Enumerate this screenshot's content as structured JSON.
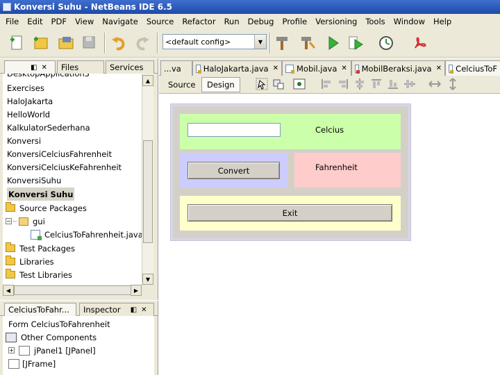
{
  "window": {
    "title": "Konversi Suhu - NetBeans IDE 6.5"
  },
  "menubar": [
    "File",
    "Edit",
    "PDF",
    "View",
    "Navigate",
    "Source",
    "Refactor",
    "Run",
    "Debug",
    "Profile",
    "Versioning",
    "Tools",
    "Window",
    "Help"
  ],
  "toolbar": {
    "config_value": "<default config>"
  },
  "projects_panel": {
    "tabs": [
      "",
      "Files",
      "Services"
    ],
    "tree": [
      {
        "label": "DesktopApplication3",
        "type": "project"
      },
      {
        "label": "Exercises",
        "type": "project"
      },
      {
        "label": "HaloJakarta",
        "type": "project"
      },
      {
        "label": "HelloWorld",
        "type": "project"
      },
      {
        "label": "KalkulatorSederhana",
        "type": "project"
      },
      {
        "label": "Konversi",
        "type": "project"
      },
      {
        "label": "KonversiCelciusFahrenheit",
        "type": "project"
      },
      {
        "label": "KonversiCelciusKeFahrenheit",
        "type": "project"
      },
      {
        "label": "KonversiSuhu",
        "type": "project"
      },
      {
        "label": "Konversi Suhu",
        "type": "project",
        "selected": true
      },
      {
        "label": "Source Packages",
        "type": "folder"
      },
      {
        "label": "gui",
        "type": "package"
      },
      {
        "label": "CelciusToFahrenheit.java",
        "type": "java"
      },
      {
        "label": "Test Packages",
        "type": "folder"
      },
      {
        "label": "Libraries",
        "type": "folder"
      },
      {
        "label": "Test Libraries",
        "type": "folder"
      }
    ]
  },
  "navigator_panel": {
    "tabs": [
      "CelciusToFahr...",
      "Inspector"
    ],
    "tree": [
      {
        "label": "Form CelciusToFahrenheit"
      },
      {
        "label": "Other Components"
      },
      {
        "label": "jPanel1 [JPanel]"
      },
      {
        "label": "[JFrame]"
      }
    ]
  },
  "editor": {
    "tabs": [
      {
        "label": "...va",
        "icon": "none"
      },
      {
        "label": "HaloJakarta.java",
        "icon": "java-file-icon"
      },
      {
        "label": "Mobil.java",
        "icon": "java-file-icon"
      },
      {
        "label": "MobilBeraksi.java",
        "icon": "java-file-error-icon"
      },
      {
        "label": "CelciusToF",
        "icon": "form-file-icon"
      }
    ],
    "view_tabs": [
      "Source",
      "Design"
    ],
    "active_view": "Design"
  },
  "form": {
    "celcius_value": "",
    "celcius_label": "Celcius",
    "fahrenheit_label": "Fahrenheit",
    "convert_label": "Convert",
    "exit_label": "Exit",
    "panel_colors": {
      "green": "#ccffaa",
      "blue": "#ccccff",
      "pink": "#ffcccc",
      "yellow": "#ffffcc"
    }
  }
}
